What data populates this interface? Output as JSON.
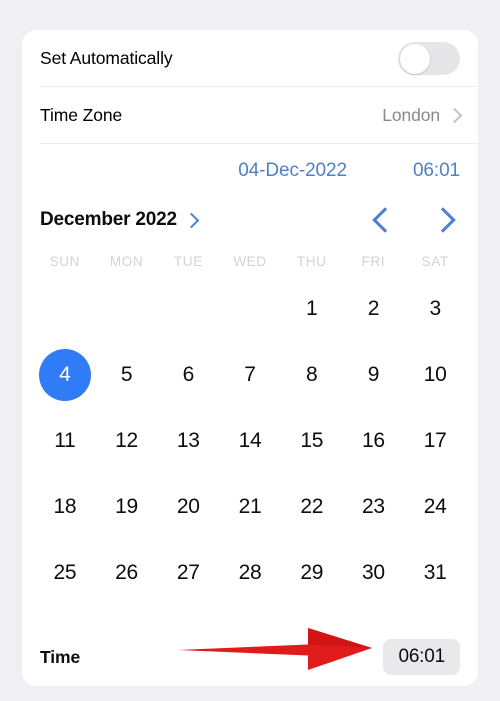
{
  "window": {
    "background_color": "#f0f0f4",
    "card_background": "#ffffff"
  },
  "settings": {
    "set_automatically": {
      "label": "Set Automatically",
      "toggle_state": "off"
    },
    "time_zone": {
      "label": "Time Zone",
      "value": "London",
      "chevron_icon": "chevron-right-icon"
    }
  },
  "summary": {
    "date": "04-Dec-2022",
    "time": "06:01",
    "accent_color": "#4c82c4"
  },
  "calendar": {
    "month_label": "December 2022",
    "month_chevron_icon": "chevron-right-icon",
    "prev_icon": "chevron-left-icon",
    "next_icon": "chevron-right-icon",
    "weekdays": [
      "SUN",
      "MON",
      "TUE",
      "WED",
      "THU",
      "FRI",
      "SAT"
    ],
    "selected_day": 4,
    "selected_color": "#2f7cf6",
    "weeks": [
      [
        "",
        "",
        "",
        "",
        "1",
        "2",
        "3"
      ],
      [
        "4",
        "5",
        "6",
        "7",
        "8",
        "9",
        "10"
      ],
      [
        "11",
        "12",
        "13",
        "14",
        "15",
        "16",
        "17"
      ],
      [
        "18",
        "19",
        "20",
        "21",
        "22",
        "23",
        "24"
      ],
      [
        "25",
        "26",
        "27",
        "28",
        "29",
        "30",
        "31"
      ]
    ]
  },
  "time_row": {
    "label": "Time",
    "value": "06:01"
  },
  "annotation": {
    "arrow_color": "#e01b1b",
    "arrow_direction": "right",
    "points_to": "time-value-pill"
  }
}
